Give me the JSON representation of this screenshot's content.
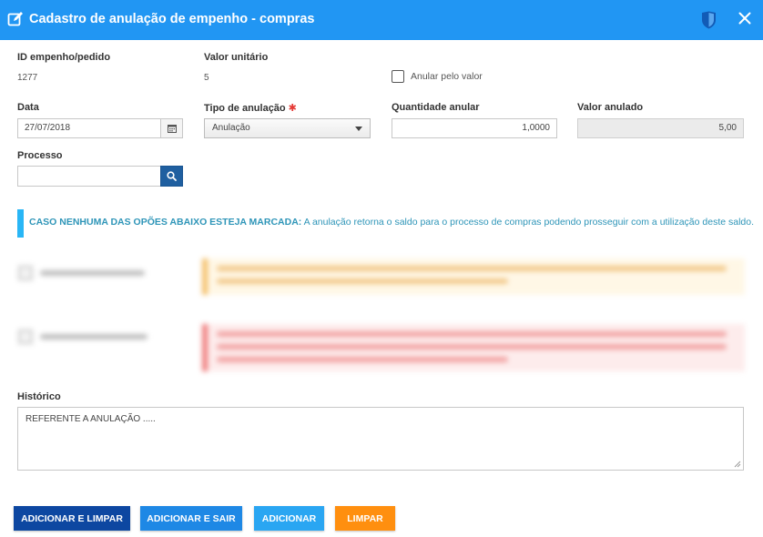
{
  "header": {
    "title": "Cadastro de anulação de empenho - compras",
    "background": "#2196f3"
  },
  "fields": {
    "id_empenho": {
      "label": "ID empenho/pedido",
      "value": "1277"
    },
    "valor_unitario": {
      "label": "Valor unitário",
      "value": "5"
    },
    "anular_pelo_valor": {
      "label": "Anular pelo valor",
      "checked": false
    },
    "data": {
      "label": "Data",
      "value": "27/07/2018"
    },
    "tipo_anulacao": {
      "label": "Tipo de anulação",
      "required_mark": "✱",
      "value": "Anulação"
    },
    "quantidade_anular": {
      "label": "Quantidade anular",
      "value": "1,0000"
    },
    "valor_anulado": {
      "label": "Valor anulado",
      "value": "5,00"
    },
    "processo": {
      "label": "Processo",
      "value": ""
    }
  },
  "info": {
    "bold": "CASO NENHUMA DAS OPÕES ABAIXO ESTEJA MARCADA:",
    "text": " A anulação retorna o saldo para o processo de compras podendo prosseguir com a utilização deste saldo.",
    "color": "#2e95b8"
  },
  "historico": {
    "label": "Histórico",
    "value": "REFERENTE A ANULAÇÃO ....."
  },
  "buttons": {
    "adicionar_limpar": {
      "label": "ADICIONAR E LIMPAR",
      "color": "#0d47a1"
    },
    "adicionar_sair": {
      "label": "ADICIONAR E SAIR",
      "color": "#1e88e5"
    },
    "adicionar": {
      "label": "ADICIONAR",
      "color": "#2aa6f2"
    },
    "limpar": {
      "label": "LIMPAR",
      "color": "#ff8f0f"
    }
  }
}
